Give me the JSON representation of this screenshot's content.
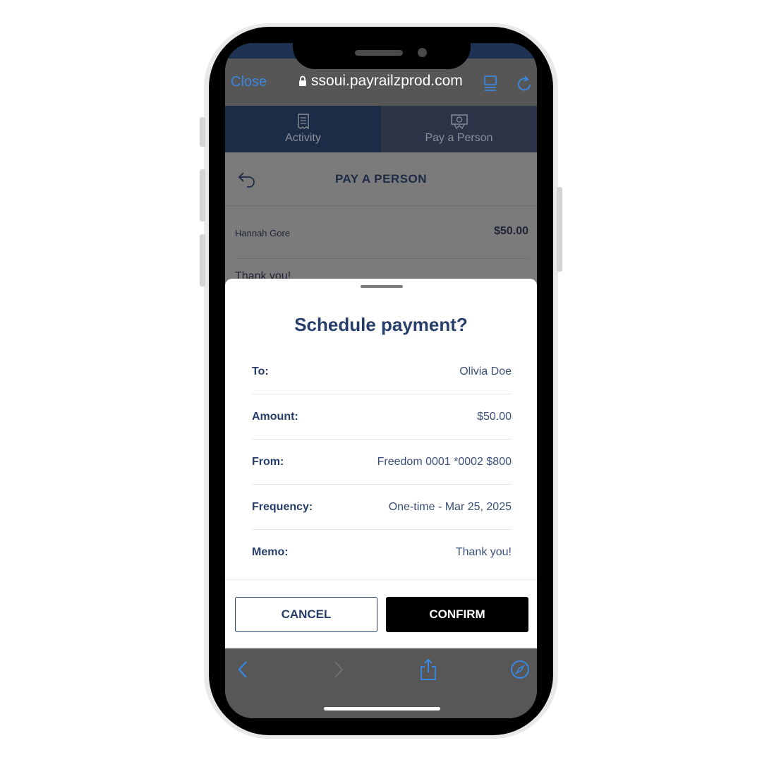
{
  "browser": {
    "close_label": "Close",
    "url": "ssoui.payrailzprod.com",
    "accent_color": "#3b87e0"
  },
  "tabs": [
    {
      "label": "Activity",
      "icon": "receipt-icon",
      "selected": false
    },
    {
      "label": "Pay a Person",
      "icon": "money-icon",
      "selected": true
    }
  ],
  "page": {
    "title": "PAY A PERSON",
    "recipient_name": "Hannah Gore",
    "recipient_amount": "$50.00",
    "memo_peek": "Thank you!"
  },
  "dialog": {
    "title": "Schedule payment?",
    "rows": [
      {
        "label": "To:",
        "value": "Olivia Doe"
      },
      {
        "label": "Amount:",
        "value": "$50.00"
      },
      {
        "label": "From:",
        "value": "Freedom 0001 *0002 $800"
      },
      {
        "label": "Frequency:",
        "value": "One-time - Mar 25, 2025"
      },
      {
        "label": "Memo:",
        "value": "Thank you!"
      }
    ],
    "cancel_label": "CANCEL",
    "confirm_label": "CONFIRM"
  },
  "colors": {
    "navy": "#273e6b",
    "confirm_bg": "#000000",
    "tab_bg": "#1c2c47"
  }
}
